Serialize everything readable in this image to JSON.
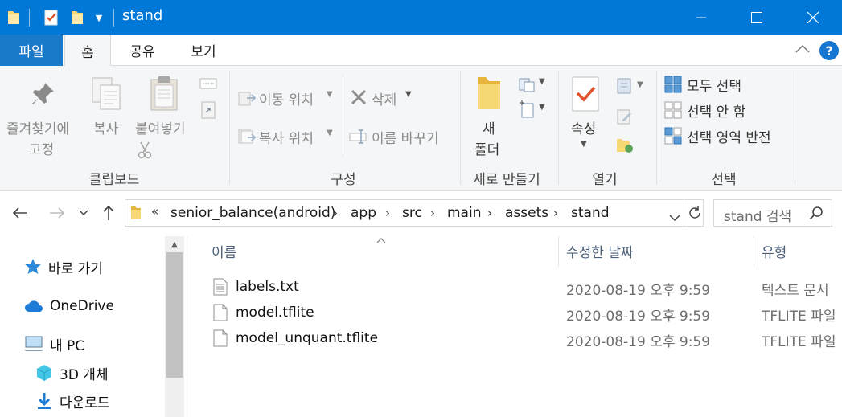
{
  "window": {
    "title": "stand",
    "accent": "#0078d7"
  },
  "ribbon_tabs": [
    "파일",
    "홈",
    "공유",
    "보기"
  ],
  "ribbon": {
    "clipboard": {
      "pin_line1": "즐겨찾기에",
      "pin_line2": "고정",
      "copy": "복사",
      "paste": "붙여넣기",
      "group": "클립보드"
    },
    "organize": {
      "move_to": "이동 위치",
      "copy_to": "복사 위치",
      "delete": "삭제",
      "rename": "이름 바꾸기",
      "group": "구성"
    },
    "new": {
      "folder_line1": "새",
      "folder_line2": "폴더",
      "group": "새로 만들기"
    },
    "open": {
      "properties": "속성",
      "group": "열기"
    },
    "select": {
      "select_all": "모두 선택",
      "select_none": "선택 안 함",
      "invert": "선택 영역 반전",
      "group": "선택"
    }
  },
  "address": {
    "overflow": "«",
    "crumbs": [
      "senior_balance(android)",
      "app",
      "src",
      "main",
      "assets",
      "stand"
    ]
  },
  "search": {
    "placeholder": "stand 검색"
  },
  "nav_pane": {
    "items": [
      {
        "label": "바로 가기",
        "icon": "star-icon"
      },
      {
        "label": "OneDrive",
        "icon": "cloud-icon"
      },
      {
        "label": "내 PC",
        "icon": "computer-icon"
      },
      {
        "label": "3D 개체",
        "icon": "cube-icon"
      },
      {
        "label": "다운로드",
        "icon": "download-icon"
      }
    ]
  },
  "file_list": {
    "columns": {
      "name": "이름",
      "date": "수정한 날짜",
      "type": "유형"
    },
    "rows": [
      {
        "name": "labels.txt",
        "date": "2020-08-19 오후 9:59",
        "type": "텍스트 문서",
        "icon": "text-file-icon"
      },
      {
        "name": "model.tflite",
        "date": "2020-08-19 오후 9:59",
        "type": "TFLITE 파일",
        "icon": "file-icon"
      },
      {
        "name": "model_unquant.tflite",
        "date": "2020-08-19 오후 9:59",
        "type": "TFLITE 파일",
        "icon": "file-icon"
      }
    ]
  }
}
